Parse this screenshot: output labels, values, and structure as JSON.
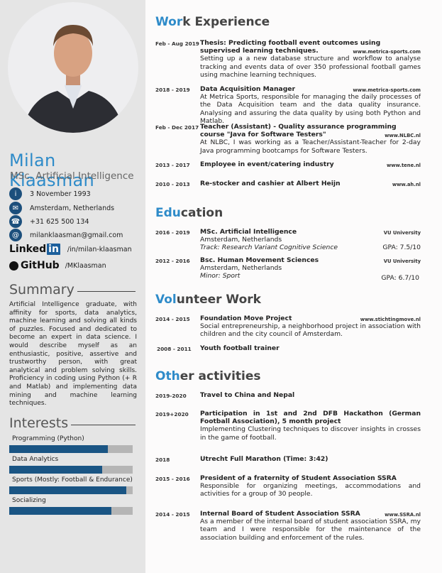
{
  "profile": {
    "name": "Milan Klaasman",
    "subtitle": "MSc. Artificial Intelligence",
    "contacts": [
      {
        "icon": "info-icon",
        "text": "3 November 1993"
      },
      {
        "icon": "envelope-icon",
        "text": "Amsterdam, Netherlands"
      },
      {
        "icon": "phone-icon",
        "text": "+31 625 500 134"
      },
      {
        "icon": "at-icon",
        "text": "milanklaasman@gmail.com"
      }
    ],
    "linkedin": {
      "logo": "Linked",
      "logo_in": "in",
      "handle": "/in/milan-klaasman"
    },
    "github": {
      "logo": "GitHub",
      "handle": "/MKlaasman"
    }
  },
  "summary": {
    "title": "Summary",
    "text": "Artificial Intelligence graduate, with affinity for sports, data analytics, machine learning and solving all kinds of puzzles.  Focused and dedicated to become an expert in data science.  I would describe myself as an enthusiastic, positive, assertive and trustworthy person, with great analytical and problem solving skills.  Proficiency in coding using Python (+ R and Matlab) and implementing data mining and machine learning techniques."
  },
  "interests": {
    "title": "Interests",
    "items": [
      {
        "label": "Programming (Python)",
        "level": 0.8
      },
      {
        "label": "Data Analytics",
        "level": 0.75
      },
      {
        "label": "Sports (Mostly: Football & Endurance)",
        "level": 0.95
      },
      {
        "label": "Socializing",
        "level": 0.83
      }
    ]
  },
  "accent": "#2e8bc9",
  "bar_color": "#1a5584",
  "work": {
    "title_a": "Wor",
    "title_b": "k Experience",
    "items": [
      {
        "date": "Feb - Aug 2019",
        "title": "Thesis: Predicting football event outcomes using supervised learning techniques.",
        "url": "www.metrica-sports.com",
        "desc": "Setting up a a new database structure and workflow to analyse tracking and events data of over 350 professional football games using machine learning techniques."
      },
      {
        "date": "2018 - 2019",
        "title": "Data Acquisition Manager",
        "url": "www.metrica-sports.com",
        "desc": "At Metrica Sports, responsible for managing the daily processes of the Data Acquisition team and the data quality insurance.  Analysing and assuring the data quality by using both Python and Matlab."
      },
      {
        "date": "Feb - Dec 2017",
        "title": "Teacher (Assistant) - Quality assurance programming course \"Java for Software Testers\"",
        "url": "www.NLBC.nl",
        "desc": "At NLBC, I was working as a Teacher/Assistant-Teacher for 2-day Java programming bootcamps for Software Testers."
      },
      {
        "date": "2013 - 2017",
        "title": "Employee in event/catering industry",
        "url": "www.tene.nl"
      },
      {
        "date": "2010 - 2013",
        "title": "Re-stocker and cashier at Albert Heijn",
        "url": "www.ah.nl"
      }
    ]
  },
  "education": {
    "title_a": "Edu",
    "title_b": "cation",
    "items": [
      {
        "date": "2016 - 2019",
        "title": "MSc. Artificial Intelligence",
        "url": "VU University",
        "place": "Amsterdam, Netherlands",
        "note": "Track: Research Variant Cognitive Science",
        "gpa": "GPA: 7.5/10"
      },
      {
        "date": "2012 - 2016",
        "title": "Bsc. Human Movement Sciences",
        "url": "VU University",
        "place": "Amsterdam, Netherlands",
        "note": "Minor: Sport",
        "gpa": "GPA: 6.7/10"
      }
    ]
  },
  "volunteer": {
    "title_a": "Vol",
    "title_b": "unteer Work",
    "items": [
      {
        "date": "2014 - 2015",
        "title": "Foundation Move Project",
        "url": "www.stichtingmove.nl",
        "desc": "Social entrepreneurship, a neighborhood project in association with children and the city council of Amsterdam."
      },
      {
        "date": "2008 - 2011",
        "title": "Youth football trainer"
      }
    ]
  },
  "other": {
    "title_a": "Oth",
    "title_b": "er activities",
    "items": [
      {
        "date": "2019-2020",
        "title": "Travel to China and Nepal"
      },
      {
        "date": "2019+2020",
        "title": "Participation in 1st and 2nd DFB Hackathon (German Football Association), 5 month project",
        "desc": "Implementing Clustering techniques to discover insights in crosses in the game of football."
      },
      {
        "date": "2018",
        "title": "Utrecht Full Marathon (Time: 3:42)"
      },
      {
        "date": "2015 - 2016",
        "title": "President of a fraternity of Student Association SSRA",
        "desc": "Responsible for organizing meetings, accommodations and activities for a group of 30 people."
      },
      {
        "date": "2014 - 2015",
        "title": "Internal Board of Student Association SSRA",
        "url": "www.SSRA.nl",
        "desc": "As a member of the internal board of student association SSRA, my team and I were responsible for the maintenance of the association building and enforcement of the rules."
      }
    ]
  }
}
